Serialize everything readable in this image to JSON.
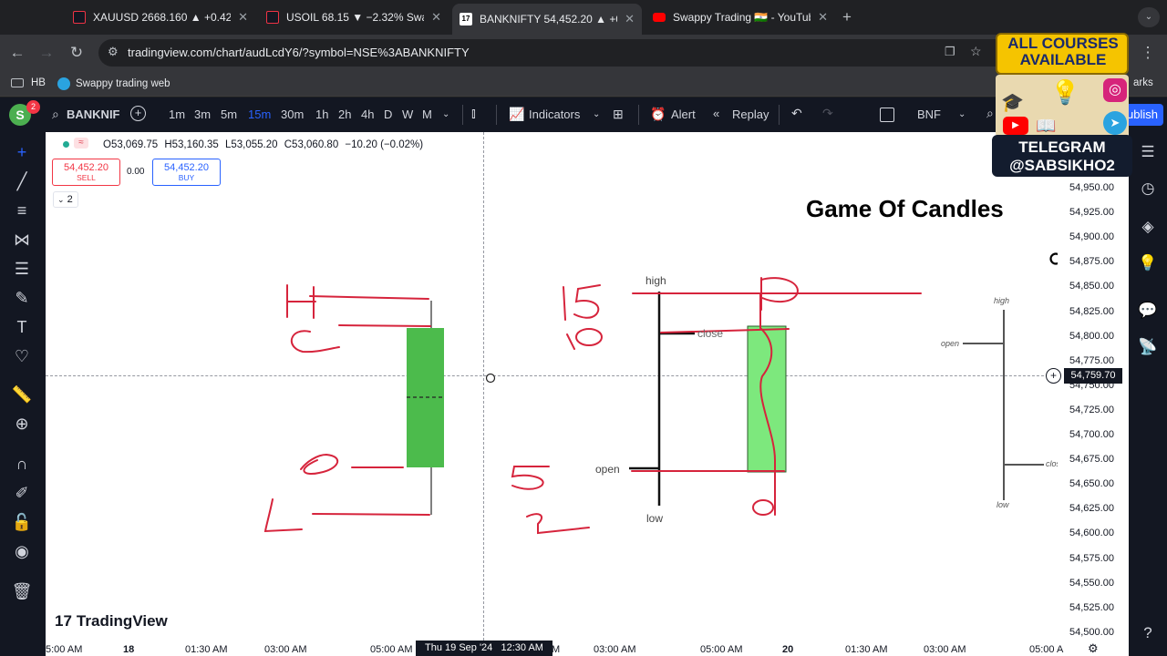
{
  "tabs": [
    {
      "title": "XAUUSD 2668.160 ▲ +0.42%",
      "active": false
    },
    {
      "title": "USOIL 68.15 ▼ −2.32% Swap",
      "active": false
    },
    {
      "title": "BANKNIFTY 54,452.20 ▲ +0.",
      "active": true
    },
    {
      "title": "Swappy Trading 🇮🇳 - YouTube",
      "active": false
    }
  ],
  "address": {
    "url": "tradingview.com/chart/audLcdY6/?symbol=NSE%3ABANKNIFTY"
  },
  "bookmarks": [
    {
      "label": "HB",
      "icon": "folder-icon"
    },
    {
      "label": "Swappy trading web",
      "icon": "telegram-icon"
    }
  ],
  "bookmarks_right": "arks",
  "tv_toolbar": {
    "avatar_letter": "S",
    "notification_count": "2",
    "symbol": "BANKNIF",
    "intervals": [
      "1m",
      "3m",
      "5m",
      "15m",
      "30m",
      "1h",
      "2h",
      "4h",
      "D",
      "W",
      "M"
    ],
    "active_interval": "15m",
    "indicators_label": "Indicators",
    "alert_label": "Alert",
    "replay_label": "Replay",
    "layout_name": "BNF",
    "publish_label": "ublish"
  },
  "promo": {
    "line1": "ALL COURSES",
    "line2": "AVAILABLE",
    "line3": "TELEGRAM",
    "line4": "@SABSIKHO2"
  },
  "legend": {
    "open": "O53,069.75",
    "high": "H53,160.35",
    "low": "L53,055.20",
    "close": "C53,060.80",
    "change": "−10.20 (−0.02%)",
    "sell_price": "54,452.20",
    "sell_label": "SELL",
    "spread": "0.00",
    "buy_price": "54,452.20",
    "buy_label": "BUY",
    "collapsed_count": "2"
  },
  "chart_title": "Game Of Candles",
  "price_axis": [
    "54,950.00",
    "54,925.00",
    "54,900.00",
    "54,875.00",
    "54,850.00",
    "54,825.00",
    "54,800.00",
    "54,775.00",
    "54,750.00",
    "54,725.00",
    "54,700.00",
    "54,675.00",
    "54,650.00",
    "54,625.00",
    "54,600.00",
    "54,575.00",
    "54,550.00",
    "54,525.00",
    "54,500.00"
  ],
  "crosshair_price": "54,759.70",
  "time_axis": [
    "5:00 AM",
    "18",
    "01:30 AM",
    "03:00 AM",
    "05:00 AM",
    "M",
    "03:00 AM",
    "05:00 AM",
    "20",
    "01:30 AM",
    "03:00 AM",
    "05:00 A"
  ],
  "crosshair_time": "Thu 19 Sep '24   12:30 AM",
  "diagram_labels": {
    "high": "high",
    "close": "close",
    "open": "open",
    "low": "low",
    "mini_high": "high",
    "mini_open": "open",
    "mini_close": "clos",
    "mini_low": "low"
  },
  "handwriting": {
    "H": "H",
    "C": "C",
    "O": "O",
    "L": "L",
    "n15": "15",
    "n10": "10",
    "n5": "5",
    "n2": "2",
    "P": "P",
    "small_o": "o",
    "right_O": "O"
  },
  "watermark": "TradingView",
  "colors": {
    "accent": "#2962ff",
    "bull_candle": "#4cbb4c",
    "bull_candle_light": "#7de87d",
    "ink": "#d6243c",
    "chart_bg": "#ffffff",
    "panel_bg": "#131722"
  }
}
